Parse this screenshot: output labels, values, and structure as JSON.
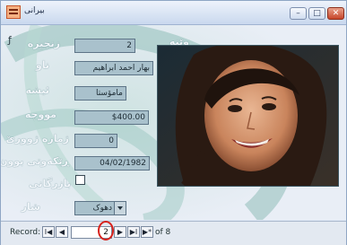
{
  "window": {
    "title": "بیرانی",
    "icon": "form-icon",
    "buttons": {
      "minimize": "–",
      "maximize": "□",
      "close": "✕"
    }
  },
  "colors": {
    "title_bar": "#c9d8ee",
    "form_background": "#e9eef6",
    "field_fill": "#a9c1cc",
    "label_text": "#f3f7fb",
    "highlight_circle": "#d8221c"
  },
  "form": {
    "corner_mark": "ƒ",
    "picture_label": "وێنە",
    "fields": [
      {
        "label": "زنجیرە",
        "value": "2"
      },
      {
        "label": "ناو",
        "value": "بهار احمد ابراهیم"
      },
      {
        "label": "ئیشە",
        "value": "مامۆستا"
      },
      {
        "label": "مووچە",
        "value": "$400.00"
      },
      {
        "label": "ژمارە ژوورێ",
        "value": "0"
      },
      {
        "label": "ڕێکەوتی بوون",
        "value": "04/02/1982"
      },
      {
        "label": "بازرگانی",
        "value": ""
      },
      {
        "label": "شار",
        "value": "دهوک"
      }
    ]
  },
  "navigation": {
    "record_label": "Record:",
    "first": "I◀",
    "previous": "◀",
    "next": "▶",
    "last": "▶I",
    "new": "▶*",
    "current_record": "2",
    "of_text": "of 8"
  }
}
